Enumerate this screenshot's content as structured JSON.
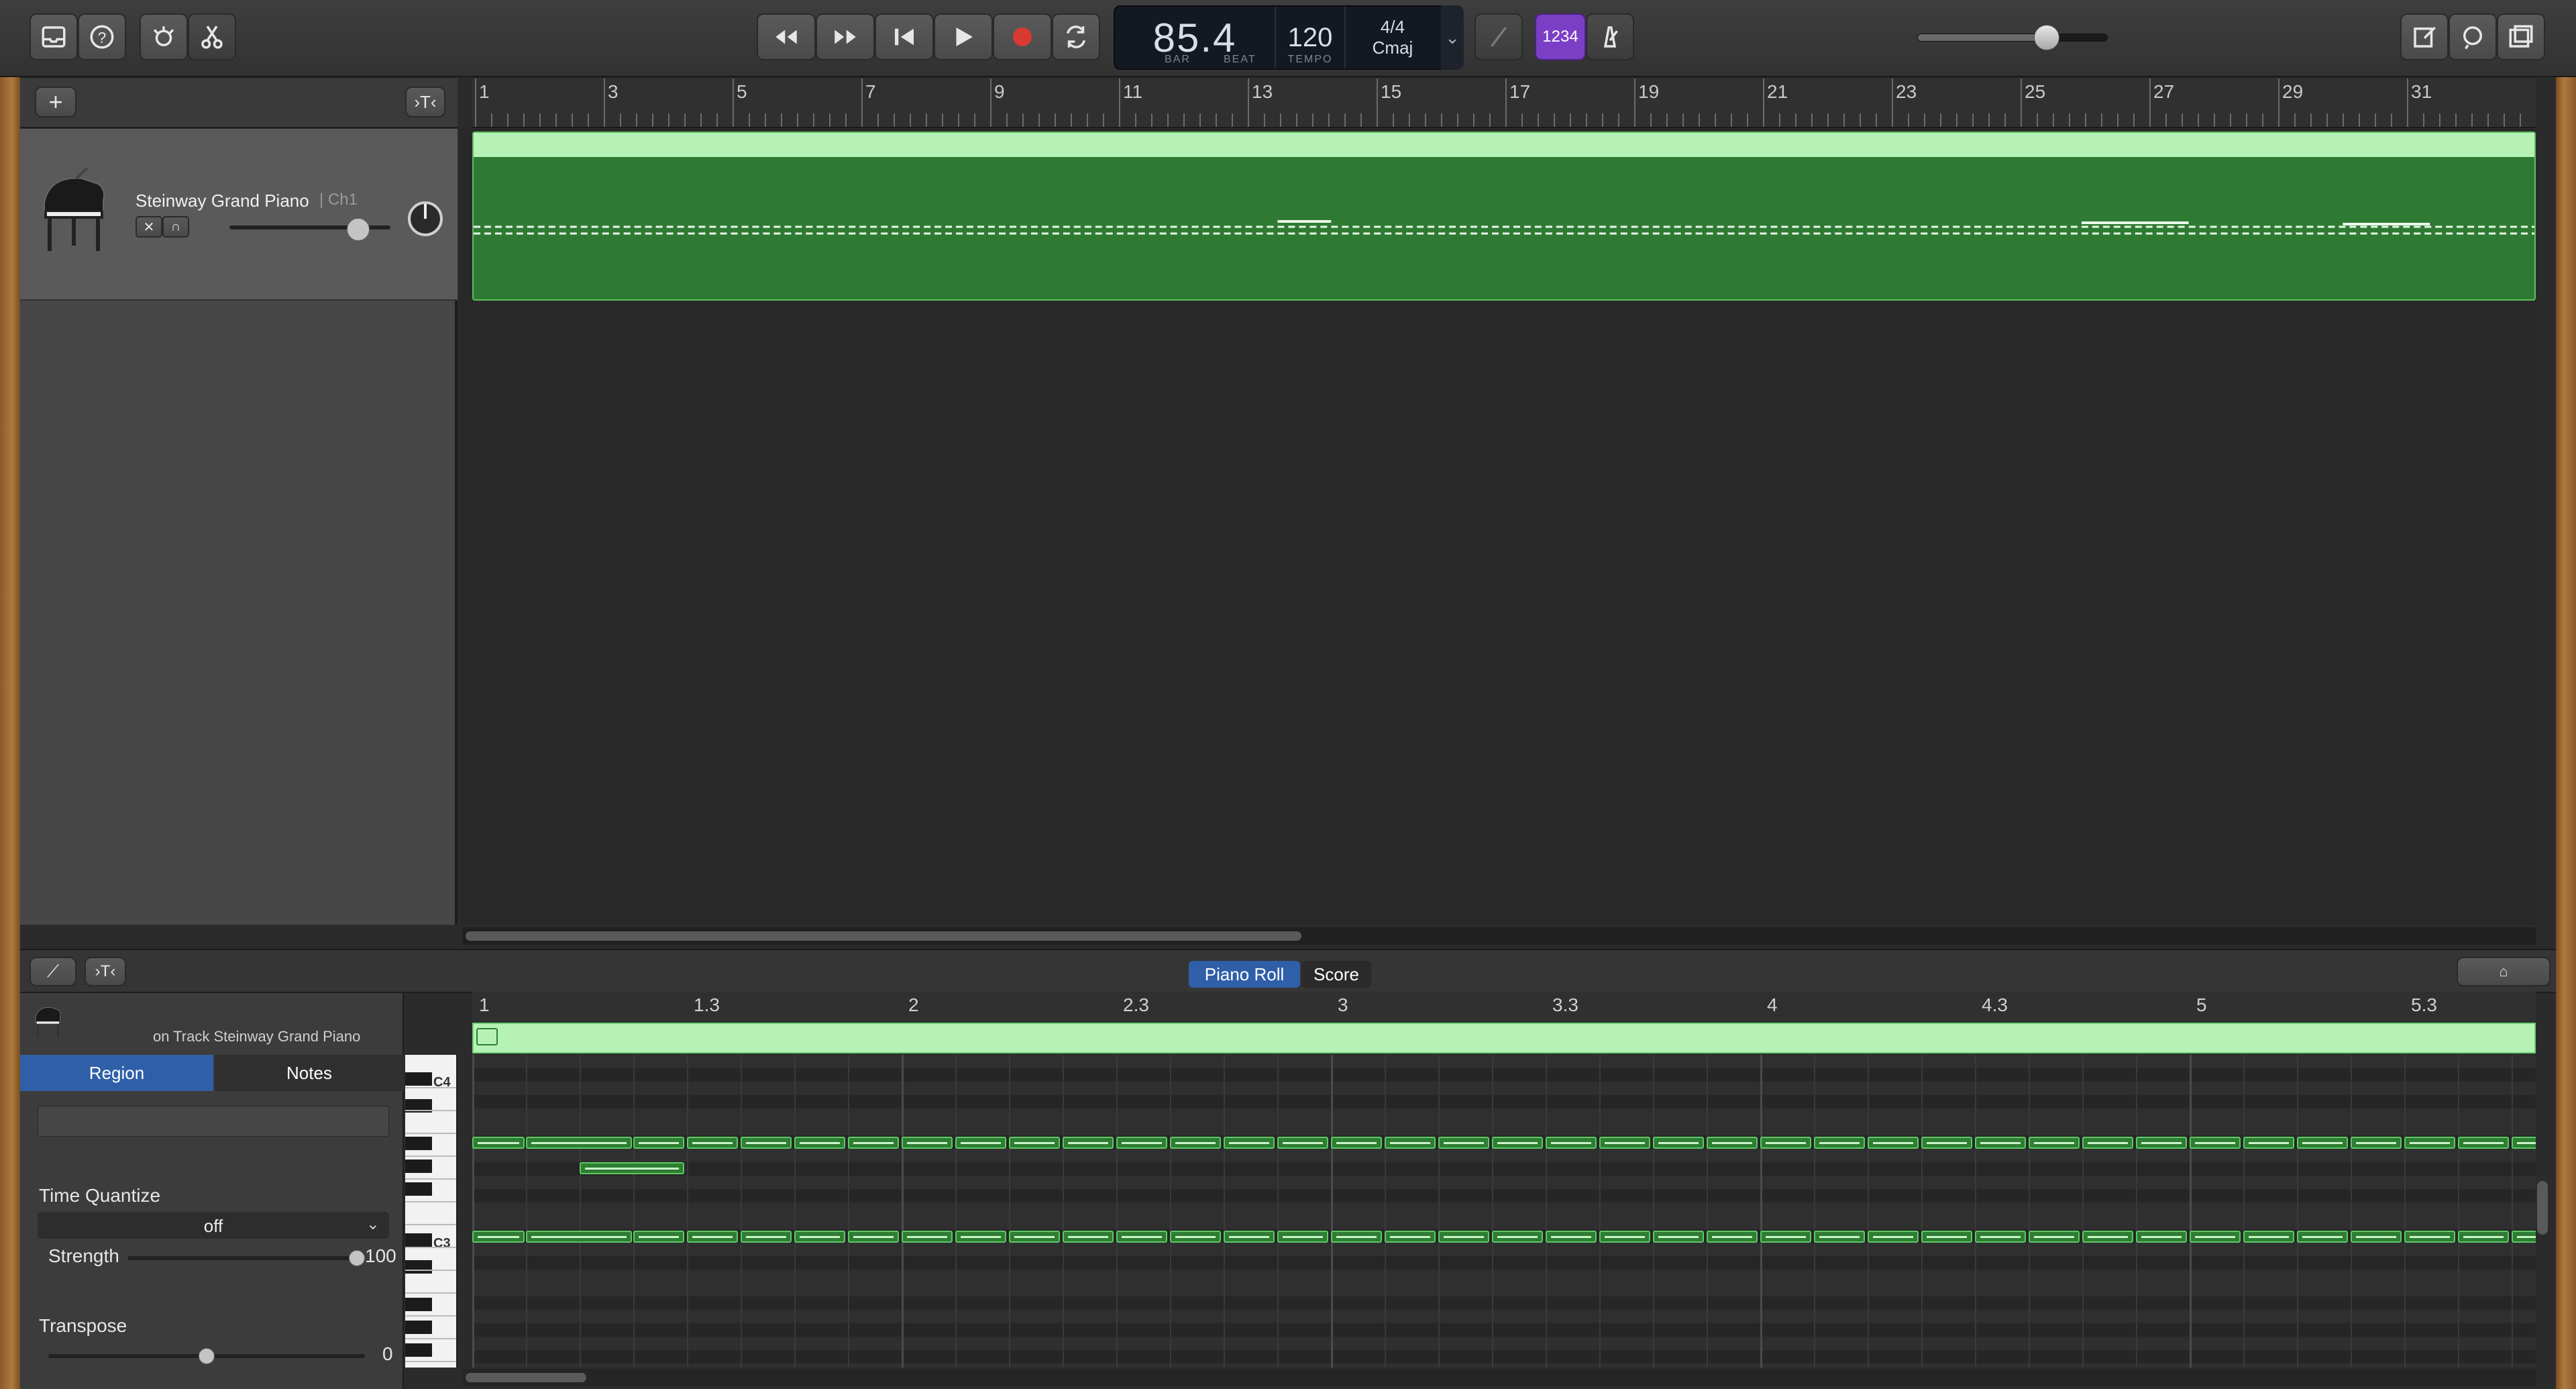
{
  "control_bar": {
    "library_icon": "library-icon",
    "help_icon": "help-icon",
    "smart_controls_icon": "smart-controls-icon",
    "editors_icon": "scissors-icon",
    "rewind_icon": "rewind-icon",
    "forward_icon": "fast-forward-icon",
    "go_to_start_icon": "go-to-start-icon",
    "play_icon": "play-icon",
    "record_icon": "record-icon",
    "cycle_icon": "cycle-icon",
    "lcd": {
      "position": "85.4",
      "bar_label": "BAR",
      "beat_label": "BEAT",
      "tempo": "120",
      "tempo_label": "TEMPO",
      "time_signature": "4/4",
      "key": "Cmaj"
    },
    "tuner_icon": "tuner-icon",
    "count_in_label": "1234",
    "metronome_icon": "metronome-icon",
    "master_volume": 0.68,
    "notepad_icon": "notepad-icon",
    "loop_browser_icon": "loop-browser-icon",
    "media_browser_icon": "media-browser-icon"
  },
  "tracks": {
    "add_track_label": "+",
    "catch_icon": "catch-icon",
    "items": [
      {
        "name": "Steinway Grand Piano",
        "channel": "| Ch1",
        "instrument_icon": "grand-piano-icon",
        "volume": 0.8
      }
    ],
    "ruler_bars": [
      "1",
      "3",
      "5",
      "7",
      "9",
      "11",
      "13",
      "15",
      "17",
      "19",
      "21",
      "23",
      "25",
      "27",
      "29",
      "31"
    ]
  },
  "editor": {
    "automation_icon": "automation-icon",
    "catch_icon": "catch-icon",
    "tabs": [
      {
        "label": "Piano Roll",
        "active": true
      },
      {
        "label": "Score",
        "active": false
      }
    ],
    "track_caption": "on Track Steinway Grand Piano",
    "inspector": {
      "tab_region": "Region",
      "tab_notes": "Notes",
      "time_quantize_label": "Time Quantize",
      "time_quantize_value": "off",
      "strength_label": "Strength",
      "strength_value": "100",
      "transpose_label": "Transpose",
      "transpose_value": "0"
    },
    "ruler_labels": [
      "1",
      "1.3",
      "2",
      "2.3",
      "3",
      "3.3",
      "4",
      "4.3",
      "5",
      "5.3"
    ],
    "key_labels": {
      "c4": "C4",
      "c3": "C3"
    },
    "accent_color": "#2f7a33"
  }
}
